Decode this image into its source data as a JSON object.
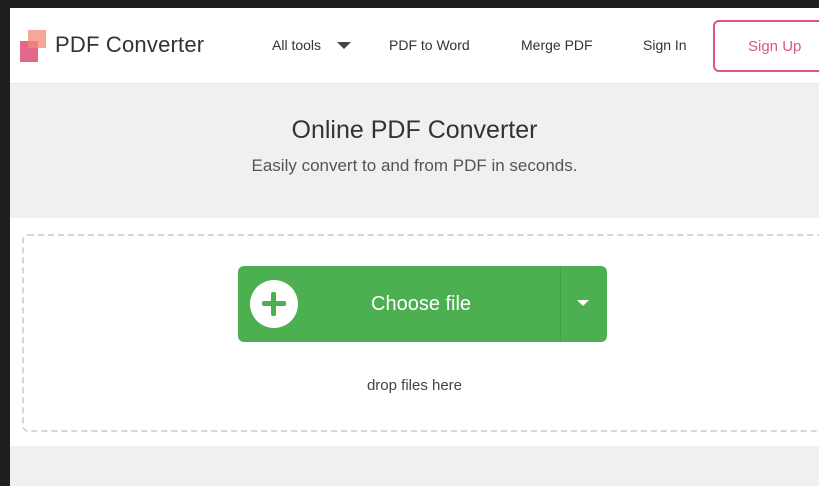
{
  "header": {
    "brand": "PDF Converter",
    "logo_icon": "stacked-squares-logo",
    "nav": {
      "all_tools": "All tools",
      "pdf_to_word": "PDF to Word",
      "merge_pdf": "Merge PDF",
      "sign_in": "Sign In",
      "sign_up": "Sign Up"
    },
    "colors": {
      "logo_light": "#f6a79a",
      "logo_dark": "#e0567c",
      "signup_border": "#e0567c"
    }
  },
  "hero": {
    "title": "Online PDF Converter",
    "subtitle": "Easily convert to and from PDF in seconds."
  },
  "upload": {
    "choose_label": "Choose file",
    "plus_icon": "plus-icon",
    "dropdown_icon": "caret-down-icon",
    "drop_text": "drop files here",
    "button_color": "#4caf50"
  }
}
